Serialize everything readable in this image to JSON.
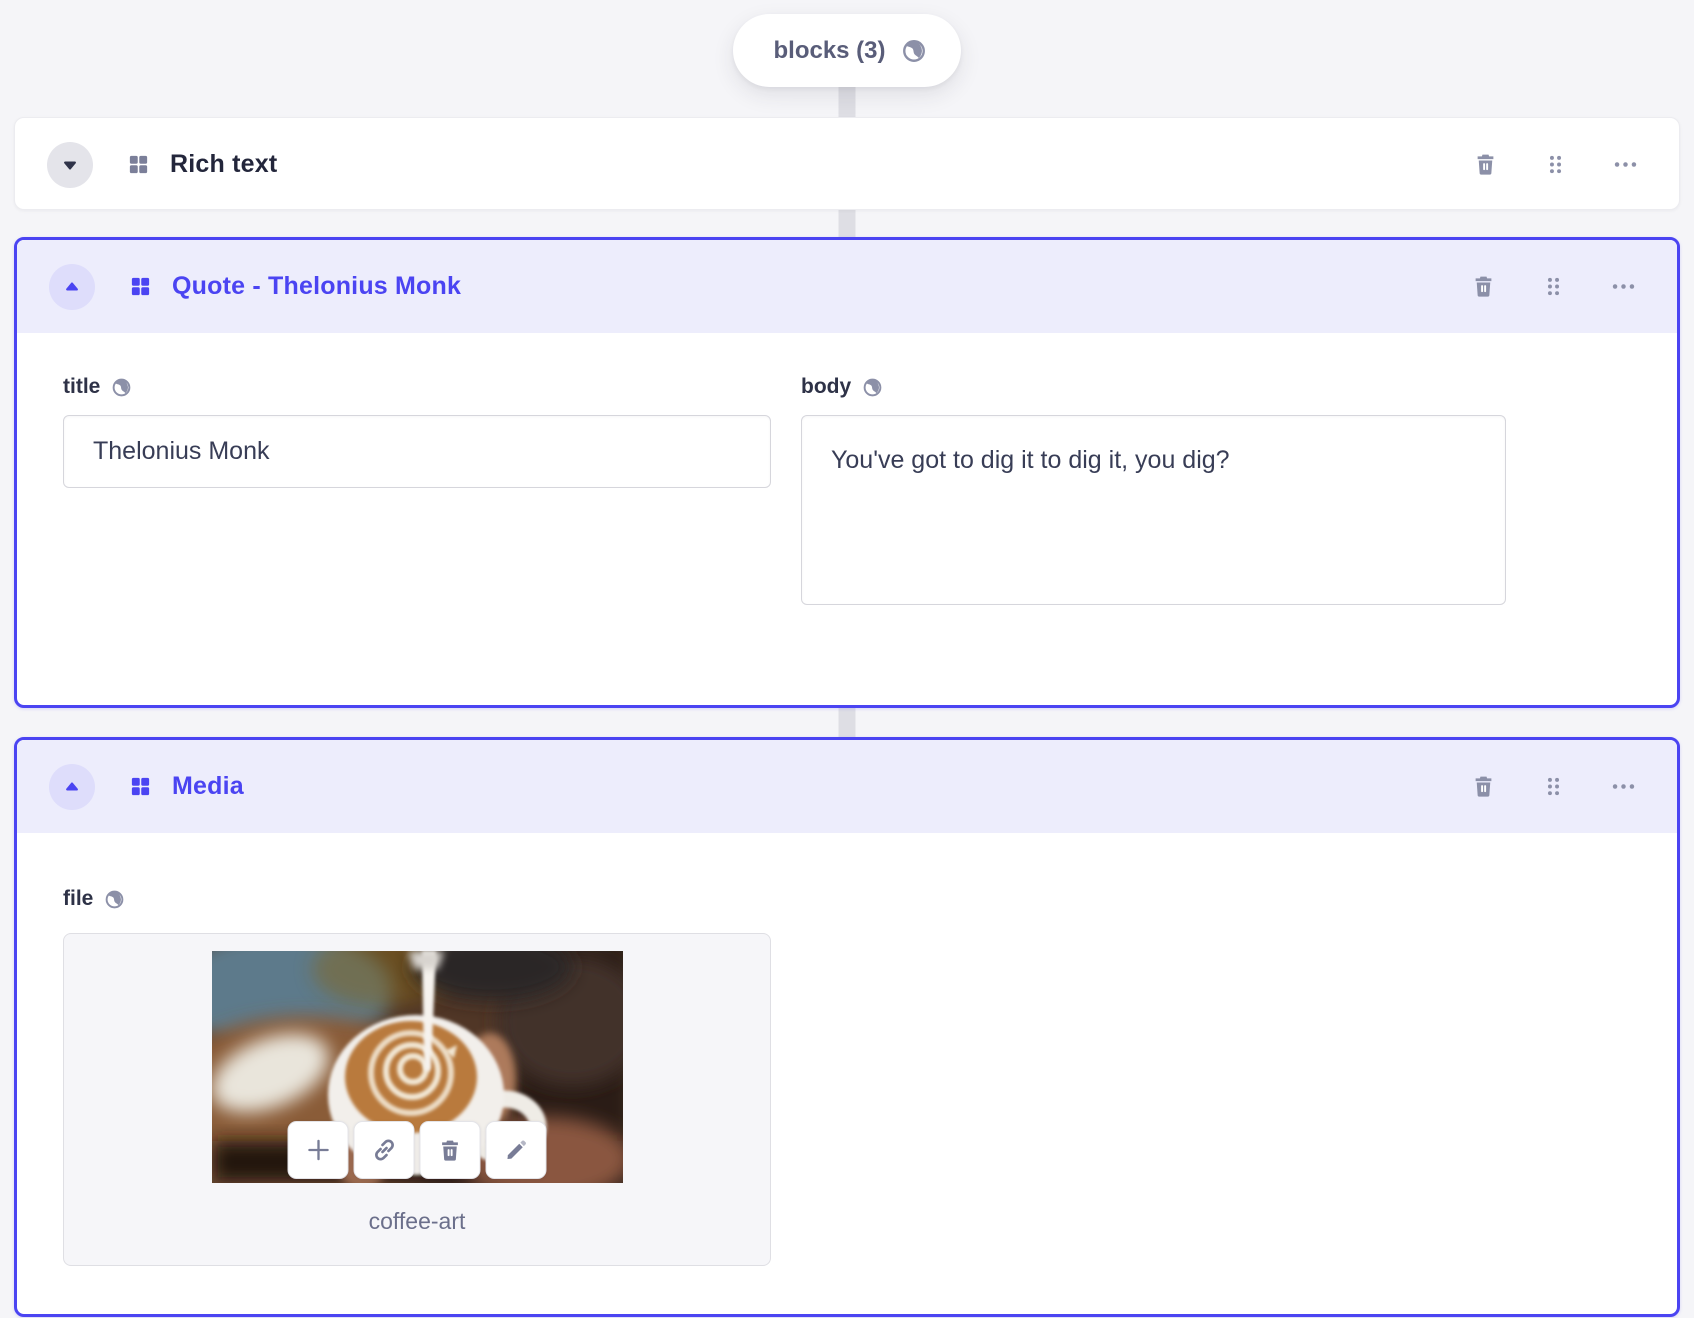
{
  "breadcrumb": {
    "label": "blocks (3)"
  },
  "blocks": {
    "rich_text": {
      "title": "Rich text"
    },
    "quote": {
      "title": "Quote - Thelonius Monk",
      "fields": {
        "title": {
          "label": "title",
          "value": "Thelonius Monk"
        },
        "body": {
          "label": "body",
          "value": "You've got to dig it to dig it, you dig?"
        }
      }
    },
    "media": {
      "title": "Media",
      "fields": {
        "file": {
          "label": "file",
          "filename": "coffee-art"
        }
      }
    }
  },
  "icons": {
    "globe": "globe-icon",
    "trash": "trash-icon",
    "drag": "drag-handle-icon",
    "more": "ellipsis-icon",
    "grid": "block-type-icon",
    "chevron_down": "chevron-down-icon",
    "chevron_up": "chevron-up-icon",
    "plus": "plus-icon",
    "link": "link-icon",
    "edit": "pencil-icon"
  },
  "colors": {
    "accent": "#4B44F2",
    "selected_header_bg": "#EDEDFC",
    "page_bg": "#F5F5F8",
    "icon_gray": "#8C90A8",
    "title_dark": "#23263B"
  }
}
